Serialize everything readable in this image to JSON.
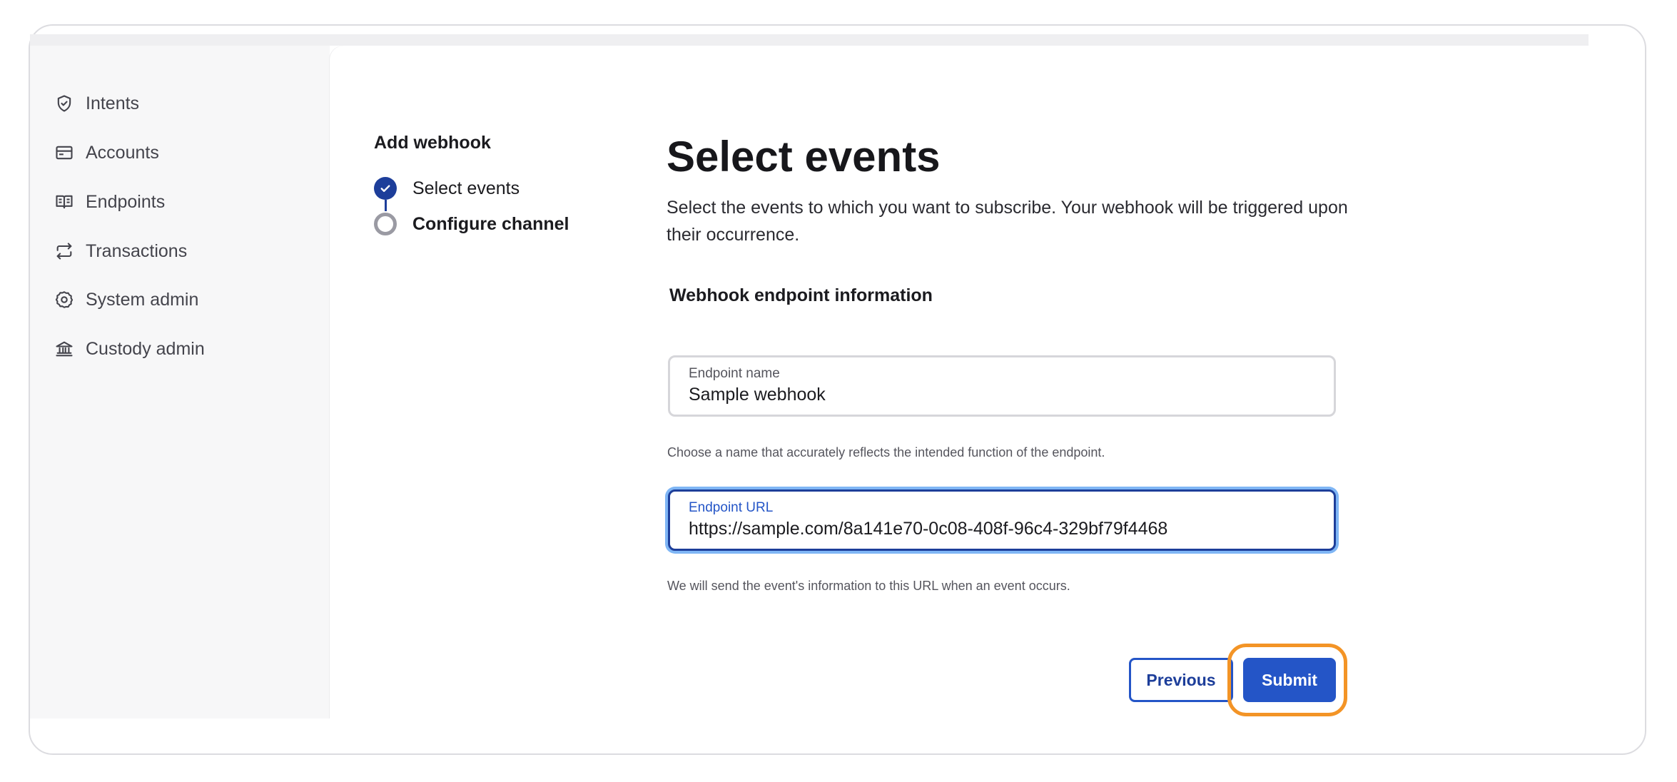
{
  "sidebar": {
    "items": [
      {
        "label": "Intents",
        "icon": "shield-check-icon"
      },
      {
        "label": "Accounts",
        "icon": "wallet-card-icon"
      },
      {
        "label": "Endpoints",
        "icon": "book-open-icon"
      },
      {
        "label": "Transactions",
        "icon": "arrows-exchange-icon"
      },
      {
        "label": "System admin",
        "icon": "gear-icon"
      },
      {
        "label": "Custody admin",
        "icon": "bank-icon"
      }
    ]
  },
  "wizard": {
    "title": "Add webhook",
    "steps": [
      {
        "label": "Select events",
        "status": "done"
      },
      {
        "label": "Configure channel",
        "status": "current"
      }
    ]
  },
  "main": {
    "title": "Select events",
    "description": "Select the events to which you want to subscribe. Your webhook will be triggered upon their occurrence.",
    "section_title": "Webhook endpoint information",
    "fields": {
      "name": {
        "label": "Endpoint name",
        "value": "Sample webhook",
        "helper": "Choose a name that accurately reflects the intended function of the endpoint."
      },
      "url": {
        "label": "Endpoint URL",
        "value": "https://sample.com/8a141e70-0c08-408f-96c4-329bf79f4468",
        "helper": "We will send the event's information to this URL when an event occurs."
      }
    },
    "buttons": {
      "previous_label": "Previous",
      "submit_label": "Submit"
    }
  },
  "colors": {
    "primary": "#2455c7",
    "primary_dark": "#1d3e9a",
    "focus_ring": "#7fb6f5",
    "highlight": "#f39426",
    "sidebar_bg": "#f7f7f8"
  }
}
